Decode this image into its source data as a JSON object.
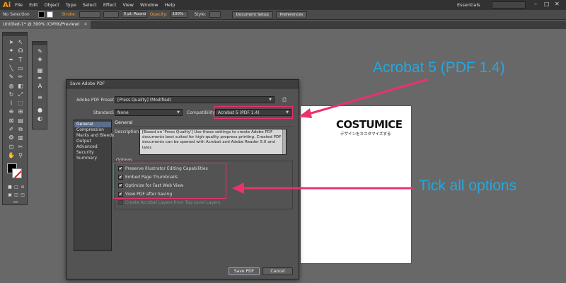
{
  "app": {
    "logo": "Ai",
    "menu": [
      "File",
      "Edit",
      "Object",
      "Type",
      "Select",
      "Effect",
      "View",
      "Window",
      "Help"
    ],
    "workspace": "Essentials",
    "window_controls": [
      "–",
      "□",
      "✕"
    ]
  },
  "control_bar": {
    "selection": "No Selection",
    "stroke_label": "Stroke:",
    "brush": "5 pt. Round",
    "opacity_label": "Opacity:",
    "opacity_value": "100%",
    "style_label": "Style:",
    "document_setup": "Document Setup",
    "preferences": "Preferences"
  },
  "document_tab": {
    "title": "Untitled-1* @ 300% (CMYK/Preview)",
    "close": "✕"
  },
  "tools": {
    "icons": [
      "selection-icon",
      "direct-selection-icon",
      "magic-wand-icon",
      "lasso-icon",
      "pen-icon",
      "type-icon",
      "line-icon",
      "rectangle-icon",
      "paintbrush-icon",
      "pencil-icon",
      "blob-brush-icon",
      "eraser-icon",
      "rotate-icon",
      "scale-icon",
      "width-icon",
      "free-transform-icon",
      "shape-builder-icon",
      "perspective-icon",
      "mesh-icon",
      "gradient-icon",
      "eyedropper-icon",
      "blend-icon",
      "symbol-sprayer-icon",
      "graph-icon",
      "artboard-icon",
      "slice-icon",
      "hand-icon",
      "zoom-icon"
    ]
  },
  "dialog": {
    "title": "Save Adobe PDF",
    "preset_label": "Adobe PDF Preset:",
    "preset_value": "[Press Quality] (Modified)",
    "standard_label": "Standard:",
    "standard_value": "None",
    "compatibility_label": "Compatibility:",
    "compatibility_value": "Acrobat 5 (PDF 1.4)",
    "categories": [
      "General",
      "Compression",
      "Marks and Bleeds",
      "Output",
      "Advanced",
      "Security",
      "Summary"
    ],
    "section_title": "General",
    "description_label": "Description:",
    "description": "[Based on 'Press Quality'] Use these settings to create Adobe PDF documents best suited for high-quality prepress printing.  Created PDF documents can be opened with Acrobat and Adobe Reader 5.0 and later.",
    "options_label": "Options",
    "options": [
      {
        "label": "Preserve Illustrator Editing Capabilities",
        "checked": true
      },
      {
        "label": "Embed Page Thumbnails",
        "checked": true
      },
      {
        "label": "Optimize for Fast Web View",
        "checked": true
      },
      {
        "label": "View PDF after Saving",
        "checked": true
      },
      {
        "label": "Create Acrobat Layers from Top-Level Layers",
        "checked": false,
        "disabled": true
      }
    ],
    "save_button": "Save PDF",
    "cancel_button": "Cancel"
  },
  "artboard": {
    "brand": "COSTUMICE",
    "subtitle": "デザインをカスタマイズする"
  },
  "annotations": {
    "compatibility_callout": "Acrobat 5 (PDF 1.4)",
    "options_callout": "Tick all options",
    "text_color": "#24a8e0",
    "highlight_color": "#e8336b"
  }
}
